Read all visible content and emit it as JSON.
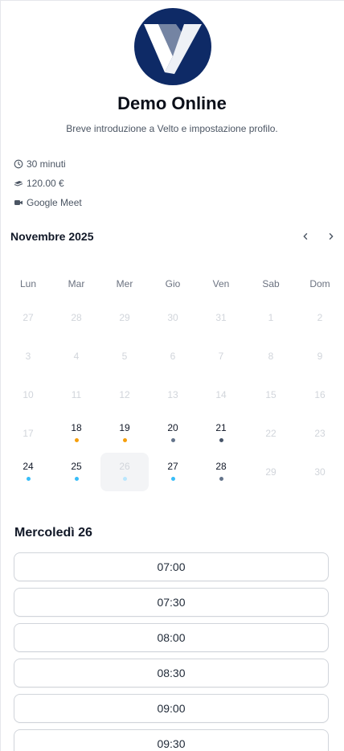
{
  "event": {
    "title": "Demo Online",
    "description": "Breve introduzione a Velto e impostazione profilo.",
    "duration": "30 minuti",
    "price": "120.00 €",
    "location": "Google Meet"
  },
  "calendar": {
    "month_label": "Novembre 2025",
    "weekdays": [
      "Lun",
      "Mar",
      "Mer",
      "Gio",
      "Ven",
      "Sab",
      "Dom"
    ],
    "weeks": [
      [
        {
          "d": "27",
          "state": "muted"
        },
        {
          "d": "28",
          "state": "muted"
        },
        {
          "d": "29",
          "state": "muted"
        },
        {
          "d": "30",
          "state": "muted"
        },
        {
          "d": "31",
          "state": "muted"
        },
        {
          "d": "1",
          "state": "muted"
        },
        {
          "d": "2",
          "state": "muted"
        }
      ],
      [
        {
          "d": "3",
          "state": "muted"
        },
        {
          "d": "4",
          "state": "muted"
        },
        {
          "d": "5",
          "state": "muted"
        },
        {
          "d": "6",
          "state": "muted"
        },
        {
          "d": "7",
          "state": "muted"
        },
        {
          "d": "8",
          "state": "muted"
        },
        {
          "d": "9",
          "state": "muted"
        }
      ],
      [
        {
          "d": "10",
          "state": "muted"
        },
        {
          "d": "11",
          "state": "muted"
        },
        {
          "d": "12",
          "state": "muted"
        },
        {
          "d": "13",
          "state": "muted"
        },
        {
          "d": "14",
          "state": "muted"
        },
        {
          "d": "15",
          "state": "muted"
        },
        {
          "d": "16",
          "state": "muted"
        }
      ],
      [
        {
          "d": "17",
          "state": "muted"
        },
        {
          "d": "18",
          "state": "active",
          "dot": "#f59e0b"
        },
        {
          "d": "19",
          "state": "active",
          "dot": "#f59e0b"
        },
        {
          "d": "20",
          "state": "active",
          "dot": "#64748b"
        },
        {
          "d": "21",
          "state": "active",
          "dot": "#475569"
        },
        {
          "d": "22",
          "state": "muted"
        },
        {
          "d": "23",
          "state": "muted"
        }
      ],
      [
        {
          "d": "24",
          "state": "active",
          "dot": "#38bdf8"
        },
        {
          "d": "25",
          "state": "active",
          "dot": "#38bdf8"
        },
        {
          "d": "26",
          "state": "selected",
          "dot": "#bae6fd"
        },
        {
          "d": "27",
          "state": "active",
          "dot": "#38bdf8"
        },
        {
          "d": "28",
          "state": "active",
          "dot": "#64748b"
        },
        {
          "d": "29",
          "state": "muted"
        },
        {
          "d": "30",
          "state": "muted"
        }
      ]
    ]
  },
  "selected_date_label": "Mercoledì 26",
  "time_slots": [
    "07:00",
    "07:30",
    "08:00",
    "08:30",
    "09:00",
    "09:30"
  ],
  "colors": {
    "logo_bg": "#0e2a66",
    "dot_orange": "#f59e0b",
    "dot_blue": "#38bdf8",
    "dot_slate": "#64748b"
  },
  "icons": {
    "duration": "clock-icon",
    "price": "money-icon",
    "location": "video-camera-icon",
    "prev": "chevron-left-icon",
    "next": "chevron-right-icon"
  }
}
